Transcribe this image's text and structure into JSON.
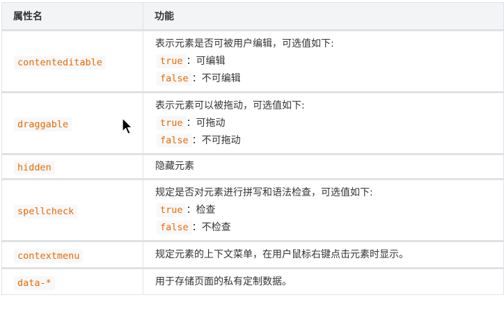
{
  "header": {
    "col_name": "属性名",
    "col_function": "功能"
  },
  "rows": [
    {
      "attr": "contenteditable",
      "desc": "表示元素是否可被用户编辑，可选值如下:",
      "options": [
        {
          "value": "true",
          "text": "：可编辑"
        },
        {
          "value": "false",
          "text": "：不可编辑"
        }
      ]
    },
    {
      "attr": "draggable",
      "desc": "表示元素可以被拖动，可选值如下:",
      "options": [
        {
          "value": "true",
          "text": "：可拖动"
        },
        {
          "value": "false",
          "text": "：不可拖动"
        }
      ]
    },
    {
      "attr": "hidden",
      "desc": "隐藏元素"
    },
    {
      "attr": "spellcheck",
      "desc": "规定是否对元素进行拼写和语法检查，可选值如下:",
      "options": [
        {
          "value": "true",
          "text": "：检查"
        },
        {
          "value": "false",
          "text": "：不检查"
        }
      ]
    },
    {
      "attr": "contextmenu",
      "desc": "规定元素的上下文菜单，在用户鼠标右键点击元素时显示。"
    },
    {
      "attr": "data-*",
      "desc": "用于存储页面的私有定制数据。"
    }
  ]
}
